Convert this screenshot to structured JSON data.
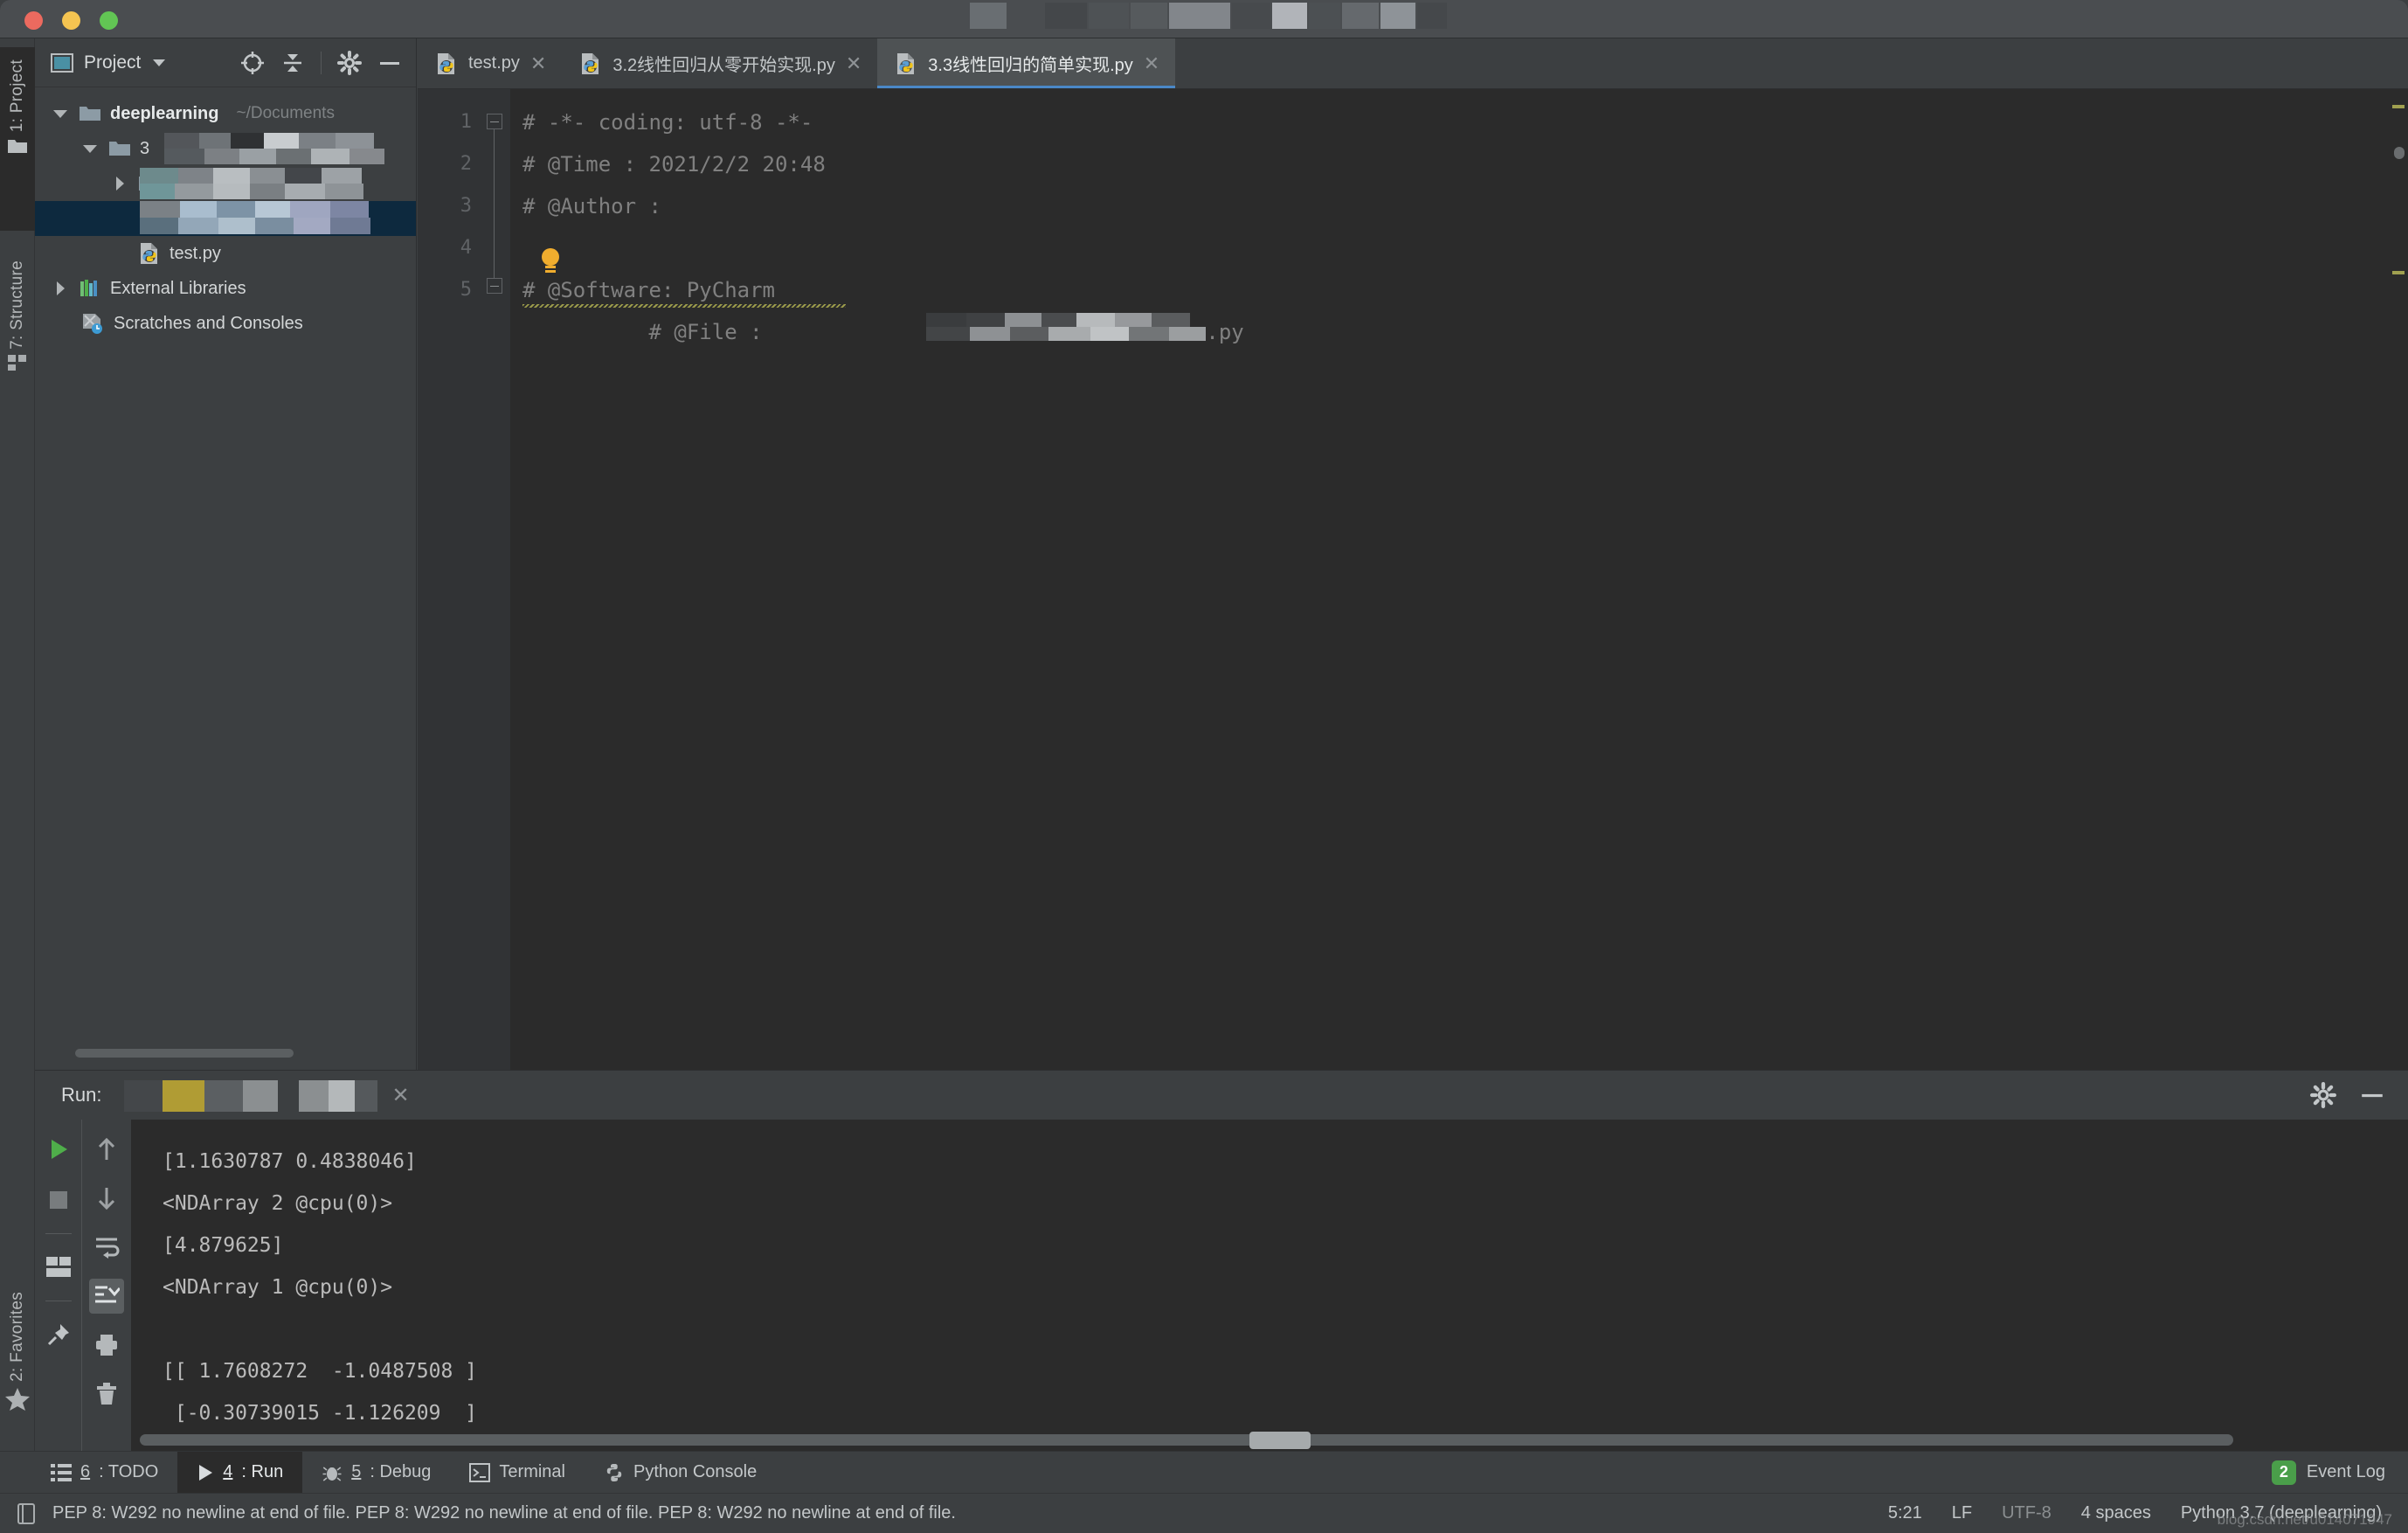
{
  "window": {
    "title_redacted": true,
    "traffic_lights": [
      "close",
      "minimize",
      "zoom"
    ]
  },
  "toolbar": {
    "run_config_redacted": true,
    "run_button": "run-icon",
    "debug_button": "debug-icon",
    "coverage_button": "coverage-icon",
    "stop_button": "stop-icon",
    "search_button": "search-icon"
  },
  "left_strip": {
    "items": [
      {
        "label": "1: Project",
        "active": true
      },
      {
        "label": "7: Structure",
        "active": false
      }
    ],
    "bottom_items": [
      {
        "label": "2: Favorites",
        "active": false
      }
    ]
  },
  "project_panel": {
    "title": "Project",
    "tree": [
      {
        "label": "deeplearning",
        "sub": "~/Documents",
        "bold": true,
        "expanded": true,
        "indent": 0,
        "icon": "folder-icon"
      },
      {
        "label": "3",
        "redacted": true,
        "expanded": true,
        "indent": 1,
        "icon": "folder-icon"
      },
      {
        "label": "",
        "redacted": true,
        "collapsed": true,
        "indent": 2,
        "icon": "folder-icon"
      },
      {
        "label": "",
        "redacted": true,
        "selected": true,
        "indent": 2,
        "icon": "python-file-icon"
      },
      {
        "label": "test.py",
        "indent": 2,
        "icon": "python-file-icon"
      },
      {
        "label": "External Libraries",
        "collapsed": true,
        "indent": 0,
        "icon": "libraries-icon"
      },
      {
        "label": "Scratches and Consoles",
        "indent": 0,
        "icon": "scratches-icon"
      }
    ]
  },
  "editor": {
    "tabs": [
      {
        "label": "test.py",
        "active": false,
        "closable": true
      },
      {
        "label": "3.2线性回归从零开始实现.py",
        "active": false,
        "closable": true
      },
      {
        "label": "3.3线性回归的简单实现.py",
        "active": true,
        "closable": true
      }
    ],
    "line_numbers": [
      "1",
      "2",
      "3",
      "4",
      "5"
    ],
    "lines": [
      "# -*- coding: utf-8 -*-",
      "# @Time : 2021/2/2 20:48",
      "# @Author : ",
      "# @File : ",
      "# @Software: PyCharm"
    ],
    "line4_suffix": ".py",
    "line4_redacted": true,
    "inspection_hint": "lightbulb-icon"
  },
  "run_panel": {
    "label": "Run:",
    "tab_redacted": true,
    "close": "×",
    "settings_icon": "gear-icon",
    "hide_icon": "minimize-icon",
    "side_icons": [
      "rerun-icon",
      "stop-icon",
      "layout-icon",
      "pin-icon"
    ],
    "side_icons2": [
      "up-arrow-icon",
      "down-arrow-icon",
      "soft-wrap-icon",
      "scroll-to-end-icon",
      "print-icon",
      "trash-icon"
    ],
    "output": [
      "[1.1630787 0.4838046]",
      "<NDArray 2 @cpu(0)>",
      "[4.879625]",
      "<NDArray 1 @cpu(0)>",
      "",
      "[[ 1.7608272  -1.0487508 ]",
      " [-0.30739015 -1.126209  ]"
    ]
  },
  "bottom_bar": {
    "items": [
      {
        "num": "6",
        "label": ": TODO",
        "icon": "todo-icon",
        "active": false
      },
      {
        "num": "4",
        "label": ": Run",
        "icon": "run-icon",
        "active": true
      },
      {
        "num": "5",
        "label": ": Debug",
        "icon": "debug-icon",
        "active": false
      },
      {
        "num": "",
        "label": "Terminal",
        "icon": "terminal-icon",
        "active": false
      },
      {
        "num": "",
        "label": "Python Console",
        "icon": "python-icon",
        "active": false
      }
    ],
    "event_log": {
      "count": "2",
      "label": "Event Log"
    }
  },
  "status_bar": {
    "message": "PEP 8: W292 no newline at end of file. PEP 8: W292 no newline at end of file. PEP 8: W292 no newline at end of file.",
    "caret": "5:21",
    "line_separator": "LF",
    "encoding": "UTF-8",
    "indent": "4 spaces",
    "interpreter": "Python 3.7 (deeplearning)",
    "watermark": "blog.csdn.net/u014071947"
  },
  "colors": {
    "chrome": "#3c3f41",
    "editor_bg": "#2b2b2b",
    "accent_blue": "#4a88c7",
    "selection_blue": "#0d293e",
    "green_run": "#4a9e4a",
    "bulb_yellow": "#f0ad2e"
  }
}
